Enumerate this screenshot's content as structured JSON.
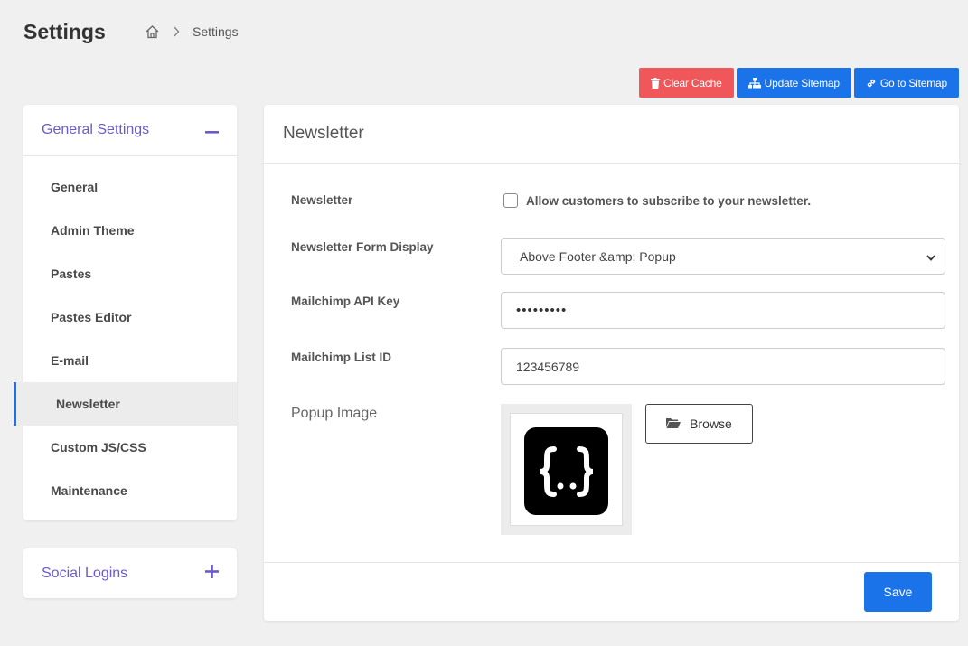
{
  "header": {
    "title": "Settings",
    "breadcrumb": {
      "home_icon": "home-icon",
      "separator_icon": "chevron-right-icon",
      "current": "Settings"
    }
  },
  "actions": {
    "clear_cache": "Clear Cache",
    "update_sitemap": "Update Sitemap",
    "go_to_sitemap": "Go to Sitemap"
  },
  "sidebar": {
    "general": {
      "title": "General Settings",
      "toggle_icon": "minus-icon",
      "items": [
        {
          "label": "General"
        },
        {
          "label": "Admin Theme"
        },
        {
          "label": "Pastes"
        },
        {
          "label": "Pastes Editor"
        },
        {
          "label": "E-mail"
        },
        {
          "label": "Newsletter",
          "active": true
        },
        {
          "label": "Custom JS/CSS"
        },
        {
          "label": "Maintenance"
        }
      ]
    },
    "social": {
      "title": "Social Logins",
      "toggle_icon": "plus-icon"
    }
  },
  "main": {
    "title": "Newsletter",
    "newsletter": {
      "label": "Newsletter",
      "checkbox_label": "Allow customers to subscribe to your newsletter.",
      "checked": false
    },
    "form_display": {
      "label": "Newsletter Form Display",
      "value": "Above Footer &amp; Popup"
    },
    "api_key": {
      "label": "Mailchimp API Key",
      "value": "•••••••••"
    },
    "list_id": {
      "label": "Mailchimp List ID",
      "value": "123456789"
    },
    "popup_image": {
      "label": "Popup Image",
      "browse_label": "Browse"
    },
    "save_label": "Save"
  },
  "colors": {
    "accent": "#1a73e8",
    "danger": "#f0575b",
    "sidebar_title": "#6a5acd"
  }
}
